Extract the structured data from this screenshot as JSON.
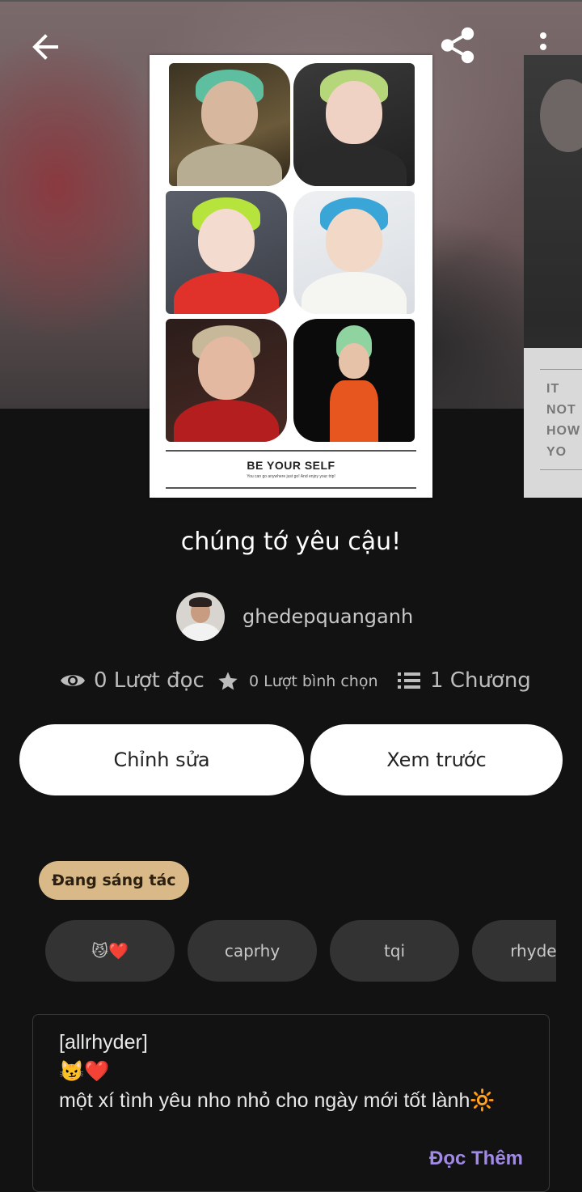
{
  "cover": {
    "title": "BE YOUR SELF",
    "subtitle": "You can go anywhere just go! And enjoy your trip!"
  },
  "cover2": {
    "panel_text": "IT\nNOT\nHOW\nYO"
  },
  "story": {
    "title": "chúng tớ yêu cậu!",
    "author": "ghedepquanganh"
  },
  "stats": {
    "reads": "0 Lượt đọc",
    "votes": "0 Lượt bình chọn",
    "chapters": "1 Chương"
  },
  "actions": {
    "edit": "Chỉnh sửa",
    "preview": "Xem trước"
  },
  "status": "Đang sáng tác",
  "tags": [
    "😼❤️",
    "caprhy",
    "tqi",
    "rhyder"
  ],
  "description": {
    "lines": [
      "[allrhyder]",
      "😼❤️",
      "một xí tình yêu nho nhỏ cho ngày mới tốt lành🔆"
    ],
    "read_more": "Đọc Thêm"
  },
  "icons": {
    "back": "back-arrow-icon",
    "share": "share-icon",
    "more": "more-vertical-icon",
    "reads": "eye-icon",
    "votes": "star-icon",
    "chapters": "list-icon"
  },
  "colors": {
    "background": "#121212",
    "badge": "#d8b987",
    "link": "#a18ae6",
    "tag": "#333333"
  }
}
